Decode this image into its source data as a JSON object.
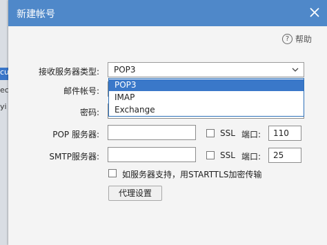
{
  "background_app": {
    "fragments": [
      "cu",
      "ecu",
      "yi"
    ]
  },
  "dialog": {
    "title": "新建帐号",
    "close_icon": "close-icon",
    "help_label": "帮助",
    "help_icon": "question-circle-icon"
  },
  "form": {
    "server_type_label": "接收服务器类型:",
    "server_type_value": "POP3",
    "account_label": "邮件帐号:",
    "password_label": "密码:",
    "pop_label": "POP 服务器:",
    "pop_server_value": "",
    "pop_ssl_label": "SSL",
    "pop_port_label": "端口:",
    "pop_port_value": "110",
    "smtp_label": "SMTP服务器:",
    "smtp_server_value": "",
    "smtp_ssl_label": "SSL",
    "smtp_port_label": "端口:",
    "smtp_port_value": "25",
    "starttls_label": "如服务器支持，用STARTTLS加密传输",
    "proxy_button": "代理设置"
  },
  "dropdown": {
    "options": [
      "POP3",
      "IMAP",
      "Exchange"
    ],
    "highlighted": "POP3"
  },
  "colors": {
    "titlebar": "#4f88c9",
    "highlight": "#3a78c9"
  }
}
